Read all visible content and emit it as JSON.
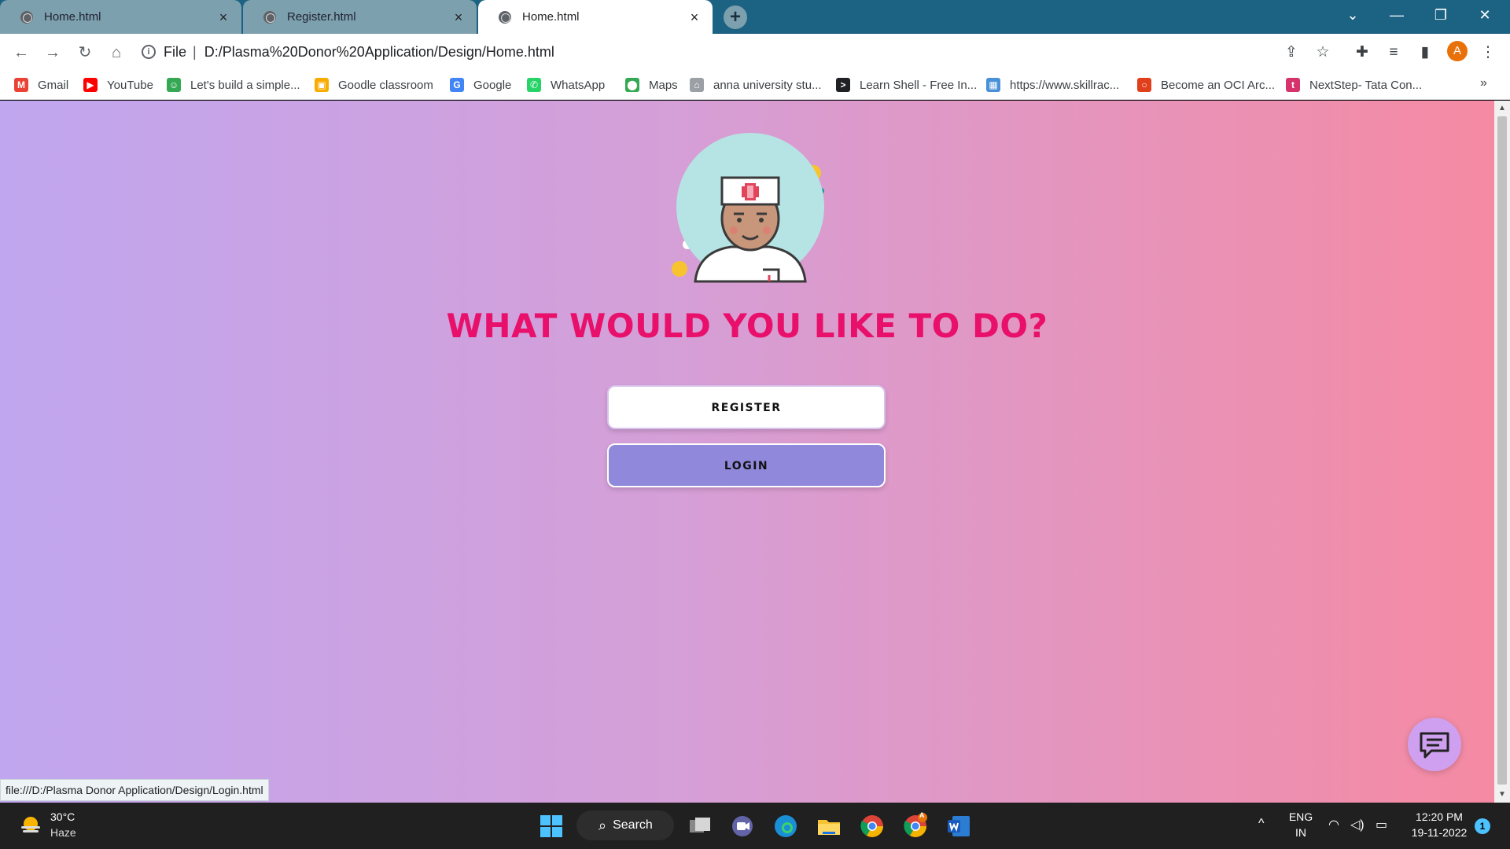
{
  "tabs": [
    {
      "title": "Home.html",
      "state": "inactive"
    },
    {
      "title": "Register.html",
      "state": "inactive"
    },
    {
      "title": "Home.html",
      "state": "active"
    }
  ],
  "tab_close_symbol": "×",
  "new_tab_symbol": "+",
  "window_controls": {
    "tab_search": "⌄",
    "minimize": "—",
    "restore": "❐",
    "close": "✕"
  },
  "toolbar": {
    "back_icon": "←",
    "forward_icon": "→",
    "reload_icon": "↻",
    "home_icon": "⌂",
    "address_scheme": "File",
    "address_separator": "|",
    "address_url": "D:/Plasma%20Donor%20Application/Design/Home.html",
    "share_icon": "⇪",
    "star_icon": "☆",
    "extensions_icon": "✚",
    "reading_list_icon": "≡",
    "side_panel_icon": "▮",
    "profile_initial": "A",
    "menu_icon": "⋮"
  },
  "bookmarks": [
    {
      "label": "Gmail",
      "icon": "gmail-icon",
      "glyph": "M",
      "color": "#ea4335"
    },
    {
      "label": "YouTube",
      "icon": "youtube-icon",
      "glyph": "▶",
      "color": "#ff0000"
    },
    {
      "label": "Let's build a simple...",
      "icon": "bot-icon",
      "glyph": "☺",
      "color": "#34a853"
    },
    {
      "label": "Goodle classroom",
      "icon": "classroom-icon",
      "glyph": "▣",
      "color": "#f9ab00"
    },
    {
      "label": "Google",
      "icon": "google-icon",
      "glyph": "G",
      "color": "#4285f4"
    },
    {
      "label": "WhatsApp",
      "icon": "whatsapp-icon",
      "glyph": "✆",
      "color": "#25d366"
    },
    {
      "label": "Maps",
      "icon": "maps-icon",
      "glyph": "⬤",
      "color": "#34a853"
    },
    {
      "label": "anna university stu...",
      "icon": "university-icon",
      "glyph": "⌂",
      "color": "#9aa0a6"
    },
    {
      "label": "Learn Shell - Free In...",
      "icon": "terminal-icon",
      "glyph": ">",
      "color": "#202124"
    },
    {
      "label": "https://www.skillrac...",
      "icon": "skillrack-icon",
      "glyph": "▦",
      "color": "#4a90d9"
    },
    {
      "label": "Become an OCI Arc...",
      "icon": "oracle-icon",
      "glyph": "○",
      "color": "#e0401c"
    },
    {
      "label": "NextStep- Tata Con...",
      "icon": "tcs-icon",
      "glyph": "t",
      "color": "#d6336c"
    }
  ],
  "bookmarks_more": "»",
  "page": {
    "headline": "WHAT WOULD YOU LIKE TO DO?",
    "register_label": "REGISTER",
    "login_label": "LOGIN",
    "status_url": "file:///D:/Plasma Donor Application/Design/Login.html"
  },
  "colors": {
    "headline": "#e8106a",
    "login_button": "#8f88db",
    "tabstrip": "#1c6283",
    "gradient_start": "#c0a6ef",
    "gradient_end": "#f58aa3"
  },
  "scrollbar": {
    "up_arrow": "▲",
    "down_arrow": "▼"
  },
  "taskbar": {
    "weather_temp": "30°C",
    "weather_condition": "Haze",
    "search_label": "Search",
    "search_glyph": "⌕",
    "tray_chevron": "^",
    "lang_top": "ENG",
    "lang_bottom": "IN",
    "wifi_glyph": "◠",
    "volume_glyph": "◁)",
    "battery_glyph": "▭",
    "time": "12:20 PM",
    "date": "19-11-2022",
    "notification_count": "1",
    "chrome_badge": "A",
    "apps": [
      "windows-start-icon",
      "task-view-icon",
      "teams-chat-icon",
      "edge-icon",
      "file-explorer-icon",
      "chrome-icon",
      "chrome-profile-icon",
      "word-icon"
    ]
  }
}
